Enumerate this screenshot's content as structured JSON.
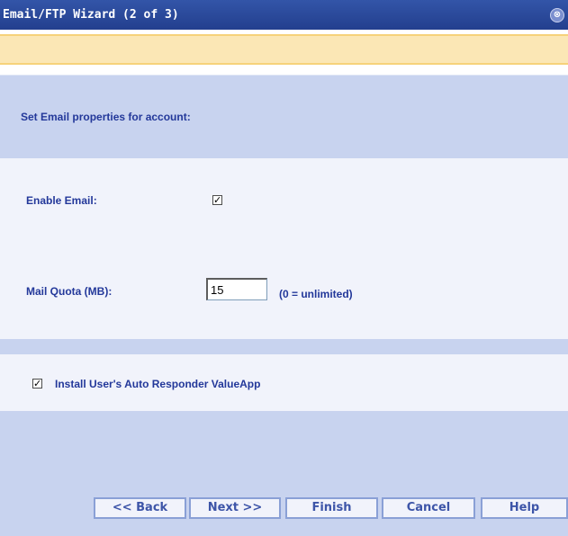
{
  "window": {
    "title": "Email/FTP Wizard (2 of 3)",
    "close_glyph": "⊗"
  },
  "section": {
    "header": "Set Email properties for account:"
  },
  "form": {
    "enable_email_label": "Enable Email:",
    "enable_email_checked": true,
    "mail_quota_label": "Mail Quota (MB):",
    "mail_quota_value": "15",
    "mail_quota_hint": "(0 = unlimited)",
    "autoresponder_label": "Install User's Auto Responder ValueApp",
    "autoresponder_checked": true
  },
  "buttons": {
    "back": "<< Back",
    "next": "Next >>",
    "finish": "Finish",
    "cancel": "Cancel",
    "help": "Help"
  },
  "glyphs": {
    "checkmark": "✓"
  },
  "colors": {
    "titlebar": "#2a469b",
    "message_bar": "#fbe7b5",
    "section_bg": "#c8d3ef",
    "form_bg": "#f1f3fb",
    "label_text": "#23389a"
  }
}
